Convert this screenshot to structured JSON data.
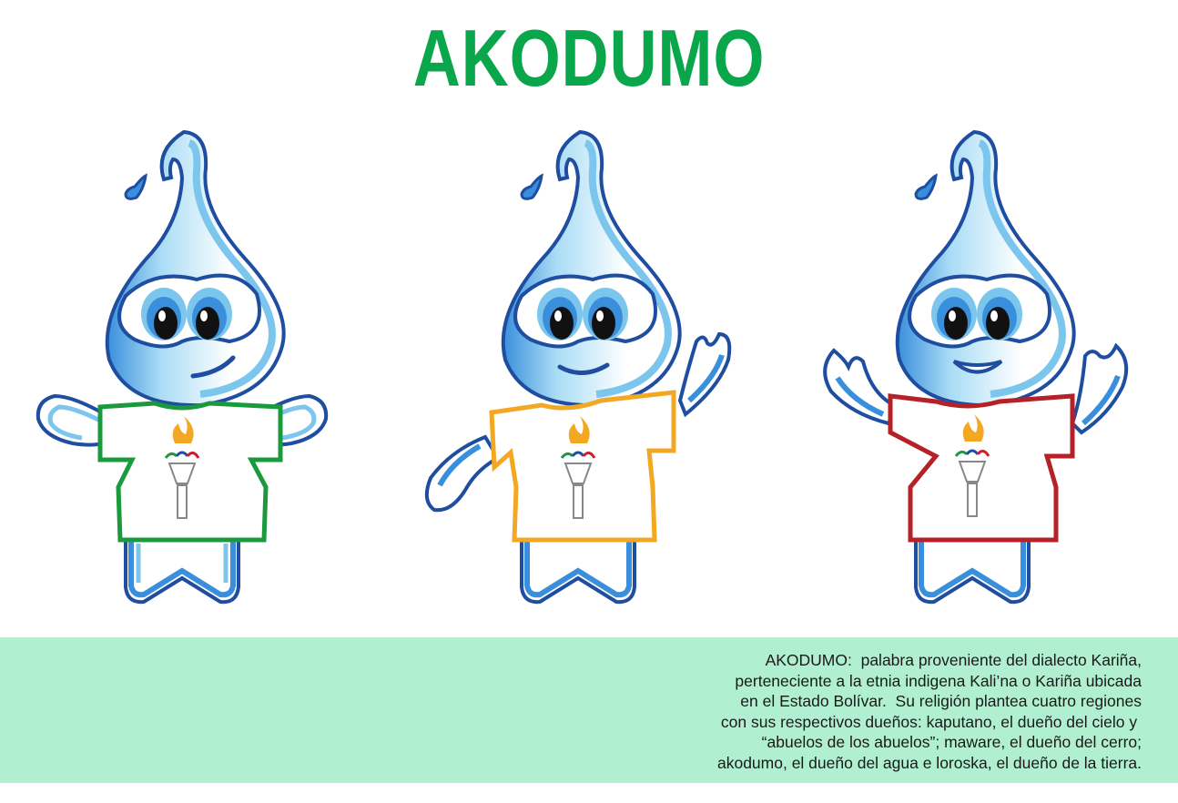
{
  "title": "AKODUMO",
  "mascots": [
    {
      "shirt_color": "#1a9a3c",
      "pose": "arms-out",
      "smile": "smirk"
    },
    {
      "shirt_color": "#f3a823",
      "pose": "waving",
      "smile": "smile"
    },
    {
      "shirt_color": "#b52127",
      "pose": "arms-up",
      "smile": "open-smile"
    }
  ],
  "colors": {
    "title": "#0aa64b",
    "outline": "#1f4ea1",
    "light_blue": "#7cc6ee",
    "mid_blue": "#3a8fdc",
    "caption_bg": "#b0f0d0"
  },
  "caption": {
    "lines": [
      "AKODUMO:  palabra proveniente del dialecto Kariña,",
      "perteneciente a la etnia indigena Kali’na o Kariña ubicada",
      "en el Estado Bolívar.  Su religión plantea cuatro regiones",
      "con sus respectivos dueños: kaputano, el dueño del cielo y ",
      "“abuelos de los abuelos”; maware, el dueño del cerro;",
      "akodumo, el dueño del agua e loroska, el dueño de la tierra."
    ]
  }
}
